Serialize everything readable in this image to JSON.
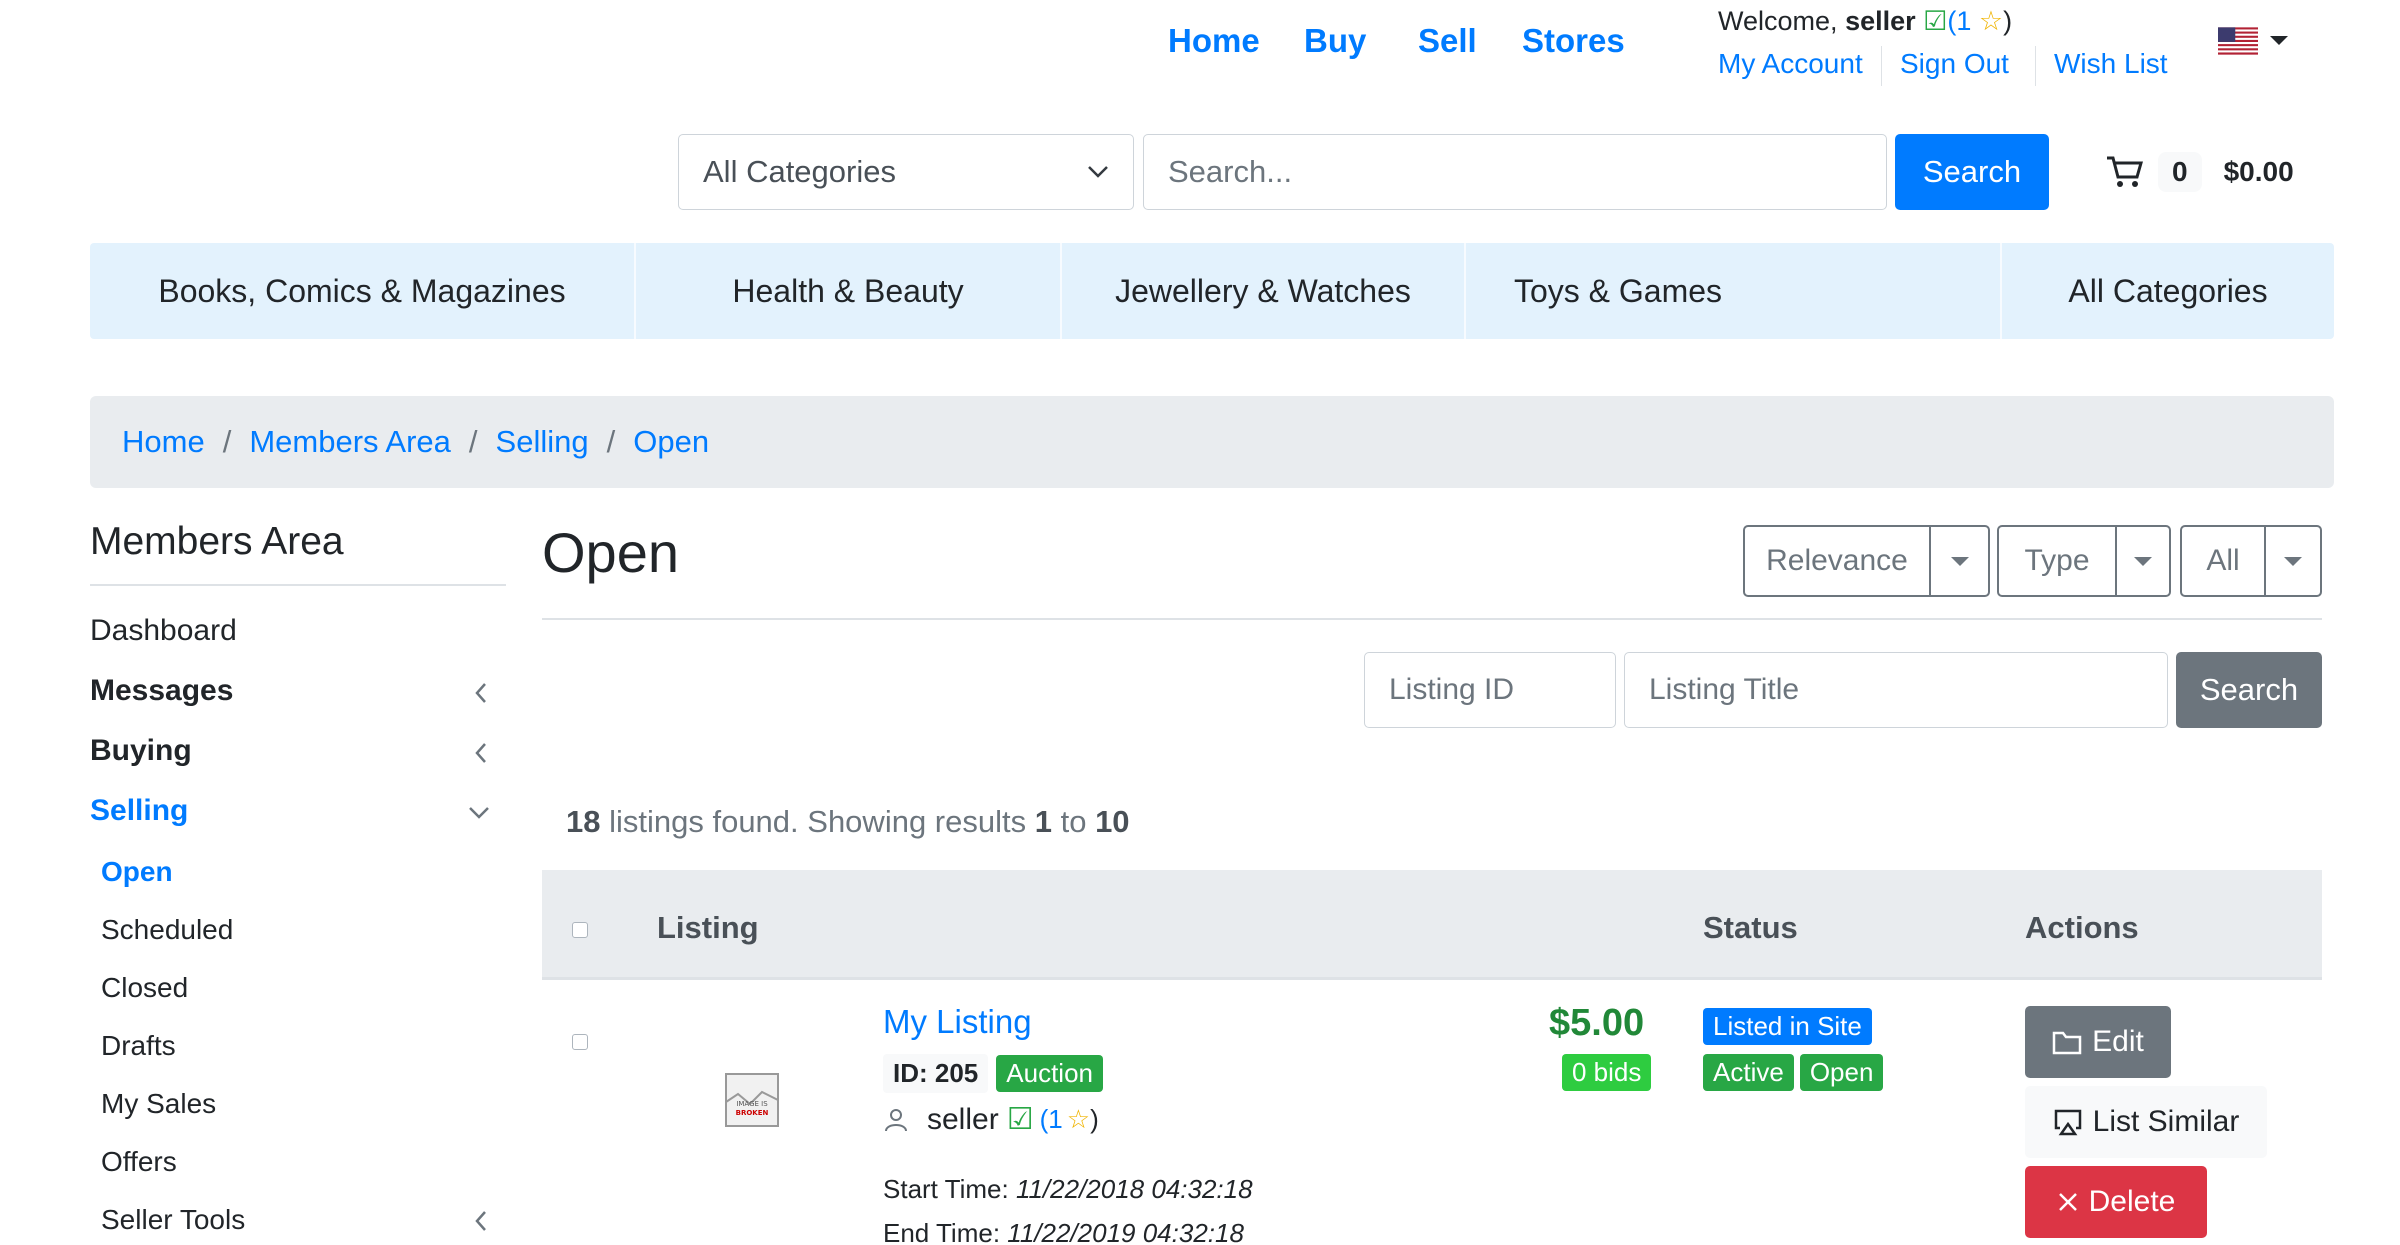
{
  "topnav": {
    "links": [
      "Home",
      "Buy",
      "Sell",
      "Stores"
    ],
    "welcome_prefix": "Welcome,",
    "username": "seller",
    "rating_open": "(",
    "rating": "1",
    "rating_close": ")",
    "account_links": [
      "My Account",
      "Sign Out",
      "Wish List"
    ],
    "locale_flag": "us-flag-icon"
  },
  "search": {
    "category_value": "All Categories",
    "placeholder": "Search...",
    "button": "Search"
  },
  "cart": {
    "count": "0",
    "total": "$0.00"
  },
  "categories": [
    "Books, Comics & Magazines",
    "Health & Beauty",
    "Jewellery & Watches",
    "Toys & Games",
    "All Categories"
  ],
  "breadcrumb": [
    "Home",
    "Members Area",
    "Selling",
    "Open"
  ],
  "breadcrumb_sep": "/",
  "sidebar": {
    "title": "Members Area",
    "items": [
      "Dashboard",
      "Messages",
      "Buying",
      "Selling"
    ],
    "sub_items": [
      "Open",
      "Scheduled",
      "Closed",
      "Drafts",
      "My Sales",
      "Offers",
      "Seller Tools"
    ]
  },
  "page": {
    "title": "Open",
    "sort_options": [
      "Relevance",
      "Type",
      "All"
    ]
  },
  "filters": {
    "listing_id_placeholder": "Listing ID",
    "listing_title_placeholder": "Listing Title",
    "button": "Search"
  },
  "results": {
    "count": "18",
    "text1": " listings found. Showing results ",
    "from": "1",
    "text2": " to ",
    "to": "10"
  },
  "table": {
    "headers": [
      "Listing",
      "Status",
      "Actions"
    ],
    "rows": [
      {
        "title": "My Listing",
        "id_label": "ID: 205",
        "type": "Auction",
        "seller": "seller",
        "rating": "1",
        "start_label": "Start Time:",
        "start_time": "11/22/2018 04:32:18",
        "end_label": "End Time:",
        "end_time": "11/22/2019 04:32:18",
        "price": "$5.00",
        "bids": "0 bids",
        "status": [
          "Listed in Site",
          "Active",
          "Open"
        ],
        "actions": [
          "Edit",
          "List Similar",
          "Delete"
        ],
        "image_caption": "IMAGE IS BROKEN"
      }
    ]
  },
  "colors": {
    "primary": "#007bff",
    "secondary": "#6c757d",
    "success": "#28a745",
    "danger": "#dc3545",
    "navbar": "#e3f2fd"
  }
}
